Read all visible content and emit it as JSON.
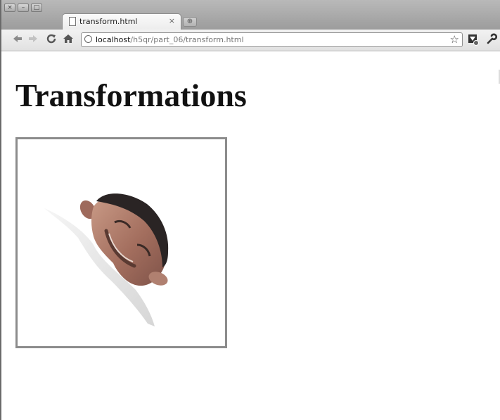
{
  "window": {
    "buttons": [
      "×",
      "–",
      "□"
    ]
  },
  "tab": {
    "title": "transform.html",
    "close_label": "×"
  },
  "new_tab_label": "⊕",
  "address_bar": {
    "host": "localhost",
    "path": "/h5qr/part_06/transform.html"
  },
  "page": {
    "heading": "Transformations"
  },
  "colors": {
    "canvas_border": "#8c8c8c",
    "face_skin": "#b07b6a",
    "hair": "#2a2424"
  },
  "icons": {
    "back": "back-arrow-icon",
    "forward": "forward-arrow-icon",
    "reload": "reload-icon",
    "home": "home-icon",
    "bookmark": "star-icon",
    "extension": "extension-icon",
    "menu": "wrench-icon"
  }
}
